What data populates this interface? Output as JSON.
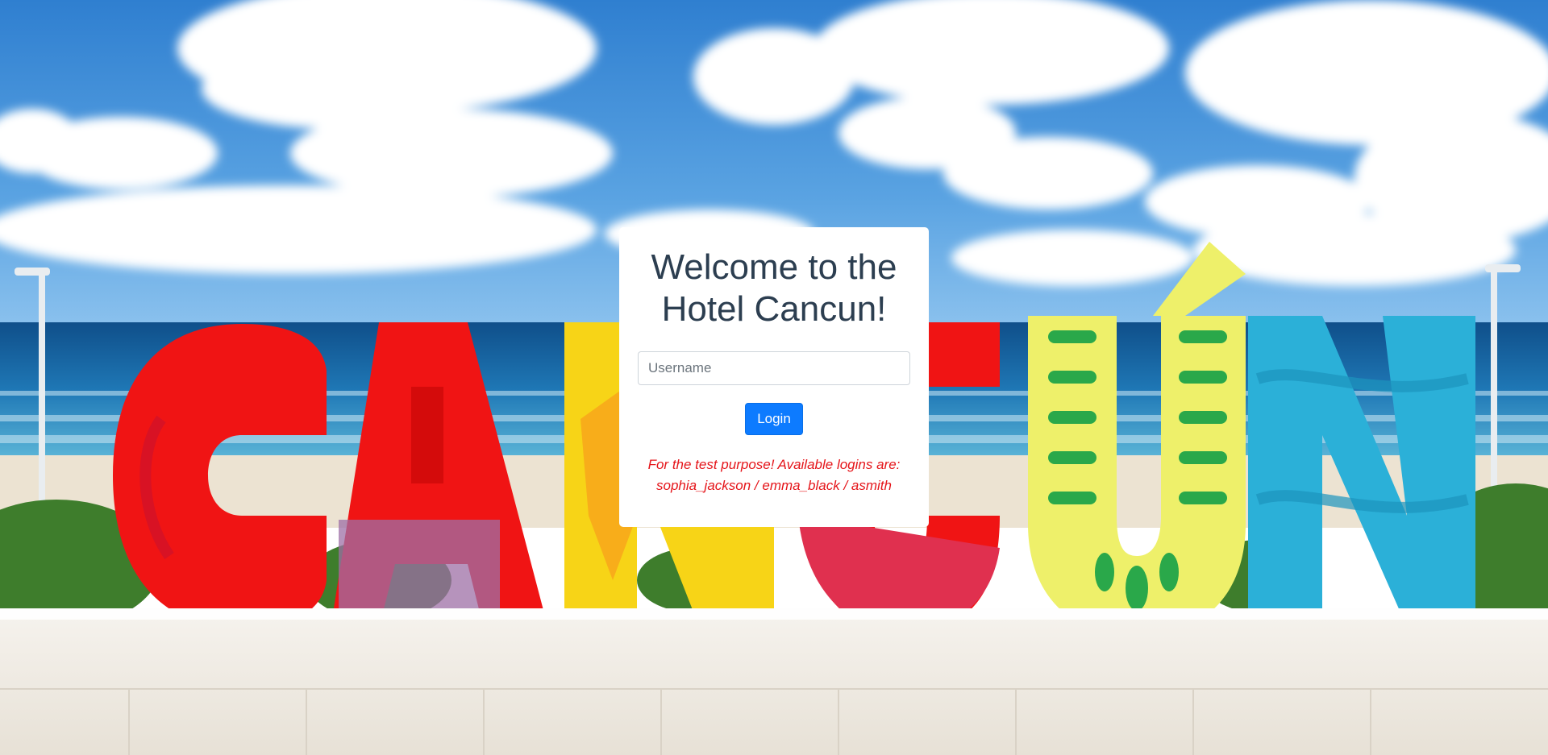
{
  "login": {
    "title_line1": "Welcome to the",
    "title_line2": "Hotel Cancun!",
    "username_placeholder": "Username",
    "username_value": "",
    "login_label": "Login",
    "note_line1": "For the test purpose! Available logins are:",
    "note_line2": "sophia_jackson / emma_black / asmith"
  },
  "background": {
    "sign_letters": [
      "C",
      "A",
      "N",
      "C",
      "Ú",
      "N"
    ],
    "colors": {
      "sky": "#3f8fd8",
      "sea": "#1d6aa8",
      "sand": "#ece3d2",
      "wall": "#f1ede6",
      "red": "#f01414",
      "yellow": "#f7d417",
      "lime": "#eef06a",
      "green": "#2aa84a",
      "cyan": "#2bb0d8"
    }
  },
  "theme": {
    "button": "#0d7bff",
    "note_text": "#e5151a",
    "title_text": "#2c3e50"
  }
}
